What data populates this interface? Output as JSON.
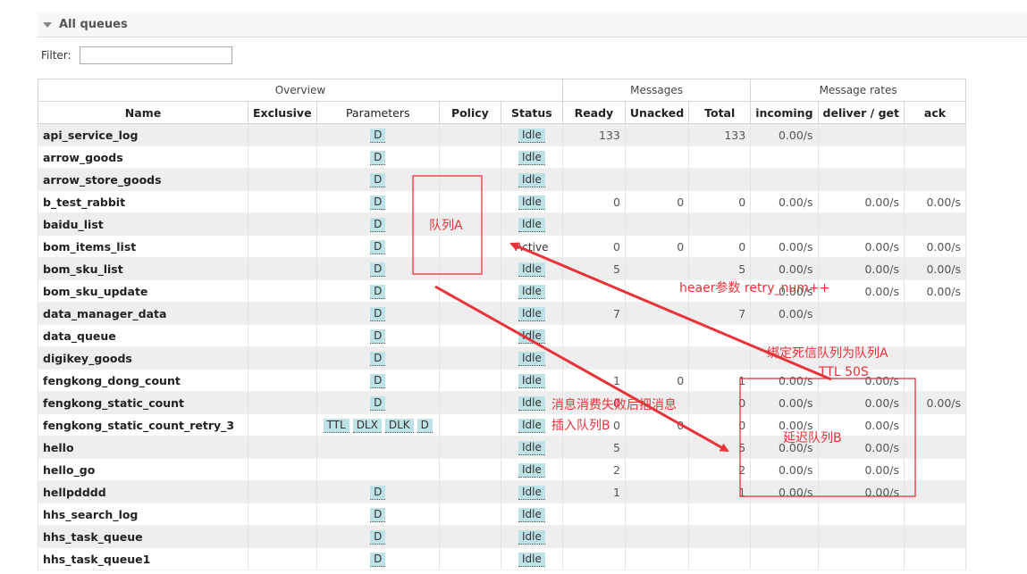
{
  "section": {
    "title": "All queues"
  },
  "filter": {
    "label": "Filter:",
    "value": ""
  },
  "groups": {
    "overview": "Overview",
    "messages": "Messages",
    "rates": "Message rates"
  },
  "columns": {
    "name": "Name",
    "exclusive": "Exclusive",
    "parameters": "Parameters",
    "policy": "Policy",
    "status": "Status",
    "ready": "Ready",
    "unacked": "Unacked",
    "total": "Total",
    "incoming": "incoming",
    "deliver_get": "deliver / get",
    "ack": "ack"
  },
  "rows": [
    {
      "name": "api_service_log",
      "params": [
        "D"
      ],
      "status": "Idle",
      "ready": "133",
      "unacked": "",
      "total": "133",
      "incoming": "0.00/s",
      "deliver": "",
      "ack": ""
    },
    {
      "name": "arrow_goods",
      "params": [
        "D"
      ],
      "status": "Idle",
      "ready": "",
      "unacked": "",
      "total": "",
      "incoming": "",
      "deliver": "",
      "ack": ""
    },
    {
      "name": "arrow_store_goods",
      "params": [
        "D"
      ],
      "status": "Idle",
      "ready": "",
      "unacked": "",
      "total": "",
      "incoming": "",
      "deliver": "",
      "ack": ""
    },
    {
      "name": "b_test_rabbit",
      "params": [
        "D"
      ],
      "status": "Idle",
      "ready": "0",
      "unacked": "0",
      "total": "0",
      "incoming": "0.00/s",
      "deliver": "0.00/s",
      "ack": "0.00/s"
    },
    {
      "name": "baidu_list",
      "params": [
        "D"
      ],
      "status": "Idle",
      "ready": "",
      "unacked": "",
      "total": "",
      "incoming": "",
      "deliver": "",
      "ack": ""
    },
    {
      "name": "bom_items_list",
      "params": [
        "D"
      ],
      "status": "Active",
      "ready": "0",
      "unacked": "0",
      "total": "0",
      "incoming": "0.00/s",
      "deliver": "0.00/s",
      "ack": "0.00/s"
    },
    {
      "name": "bom_sku_list",
      "params": [
        "D"
      ],
      "status": "Idle",
      "ready": "5",
      "unacked": "",
      "total": "5",
      "incoming": "0.00/s",
      "deliver": "0.00/s",
      "ack": "0.00/s"
    },
    {
      "name": "bom_sku_update",
      "params": [
        "D"
      ],
      "status": "Idle",
      "ready": "",
      "unacked": "",
      "total": "",
      "incoming": "0.00/s",
      "deliver": "0.00/s",
      "ack": "0.00/s"
    },
    {
      "name": "data_manager_data",
      "params": [
        "D"
      ],
      "status": "Idle",
      "ready": "7",
      "unacked": "",
      "total": "7",
      "incoming": "0.00/s",
      "deliver": "",
      "ack": ""
    },
    {
      "name": "data_queue",
      "params": [
        "D"
      ],
      "status": "Idle",
      "ready": "",
      "unacked": "",
      "total": "",
      "incoming": "",
      "deliver": "",
      "ack": ""
    },
    {
      "name": "digikey_goods",
      "params": [
        "D"
      ],
      "status": "Idle",
      "ready": "",
      "unacked": "",
      "total": "",
      "incoming": "",
      "deliver": "",
      "ack": ""
    },
    {
      "name": "fengkong_dong_count",
      "params": [
        "D"
      ],
      "status": "Idle",
      "ready": "1",
      "unacked": "0",
      "total": "1",
      "incoming": "0.00/s",
      "deliver": "0.00/s",
      "ack": ""
    },
    {
      "name": "fengkong_static_count",
      "params": [
        "D"
      ],
      "status": "Idle",
      "ready": "0",
      "unacked": "",
      "total": "0",
      "incoming": "0.00/s",
      "deliver": "0.00/s",
      "ack": "0.00/s"
    },
    {
      "name": "fengkong_static_count_retry_3",
      "params": [
        "TTL",
        "DLX",
        "DLK",
        "D"
      ],
      "status": "Idle",
      "ready": "0",
      "unacked": "0",
      "total": "0",
      "incoming": "0.00/s",
      "deliver": "0.00/s",
      "ack": ""
    },
    {
      "name": "hello",
      "params": [],
      "status": "Idle",
      "ready": "5",
      "unacked": "",
      "total": "5",
      "incoming": "0.00/s",
      "deliver": "0.00/s",
      "ack": ""
    },
    {
      "name": "hello_go",
      "params": [],
      "status": "Idle",
      "ready": "2",
      "unacked": "",
      "total": "2",
      "incoming": "0.00/s",
      "deliver": "0.00/s",
      "ack": ""
    },
    {
      "name": "hellpdddd",
      "params": [
        "D"
      ],
      "status": "Idle",
      "ready": "1",
      "unacked": "",
      "total": "1",
      "incoming": "0.00/s",
      "deliver": "0.00/s",
      "ack": ""
    },
    {
      "name": "hhs_search_log",
      "params": [
        "D"
      ],
      "status": "Idle",
      "ready": "",
      "unacked": "",
      "total": "",
      "incoming": "",
      "deliver": "",
      "ack": ""
    },
    {
      "name": "hhs_task_queue",
      "params": [
        "D"
      ],
      "status": "Idle",
      "ready": "",
      "unacked": "",
      "total": "",
      "incoming": "",
      "deliver": "",
      "ack": ""
    },
    {
      "name": "hhs_task_queue1",
      "params": [
        "D"
      ],
      "status": "Idle",
      "ready": "",
      "unacked": "",
      "total": "",
      "incoming": "",
      "deliver": "",
      "ack": ""
    }
  ],
  "annotations": {
    "queue_a": "队列A",
    "header_param": "heaer参数 retry_num++",
    "bind_dlq": "绑定死信队列为队列A",
    "ttl": "TTL 50S",
    "fail_line1": "消息消费失败后把消息",
    "fail_line2": "插入队列B",
    "delay_queue_b": "延迟队列B"
  },
  "colors": {
    "annotation": "#e8333a",
    "tag_bg": "#bde3e6",
    "odd_row": "#eeeeee"
  }
}
